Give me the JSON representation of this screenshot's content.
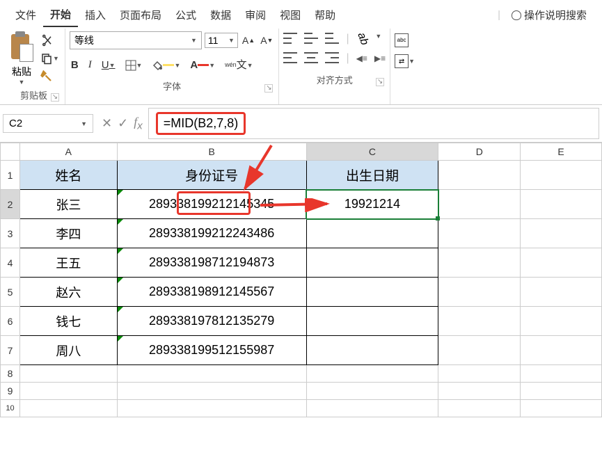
{
  "tabs": {
    "file": "文件",
    "home": "开始",
    "insert": "插入",
    "layout": "页面布局",
    "formula": "公式",
    "data": "数据",
    "review": "审阅",
    "view": "视图",
    "help": "帮助",
    "tellme": "操作说明搜索"
  },
  "ribbon": {
    "paste": "粘贴",
    "clipboard": "剪贴板",
    "font_name": "等线",
    "font_size": "11",
    "font_group": "字体",
    "align_group": "对齐方式",
    "wen": "wén",
    "wen_char": "文",
    "abc": "abc"
  },
  "fbar": {
    "cell_ref": "C2",
    "formula": "=MID(B2,7,8)"
  },
  "cols": {
    "A": "A",
    "B": "B",
    "C": "C",
    "D": "D",
    "E": "E"
  },
  "headers": {
    "name": "姓名",
    "id": "身份证号",
    "dob": "出生日期"
  },
  "rows": [
    {
      "n": "1"
    },
    {
      "n": "2",
      "name": "张三",
      "id": "289338199212145345",
      "id_pre": "289338",
      "id_mid": "19921214",
      "id_post": "5345",
      "dob": "19921214"
    },
    {
      "n": "3",
      "name": "李四",
      "id": "289338199212243486"
    },
    {
      "n": "4",
      "name": "王五",
      "id": "289338198712194873"
    },
    {
      "n": "5",
      "name": "赵六",
      "id": "289338198912145567"
    },
    {
      "n": "6",
      "name": "钱七",
      "id": "289338197812135279"
    },
    {
      "n": "7",
      "name": "周八",
      "id": "289338199512155987"
    },
    {
      "n": "8"
    },
    {
      "n": "9"
    },
    {
      "n": "10"
    }
  ]
}
